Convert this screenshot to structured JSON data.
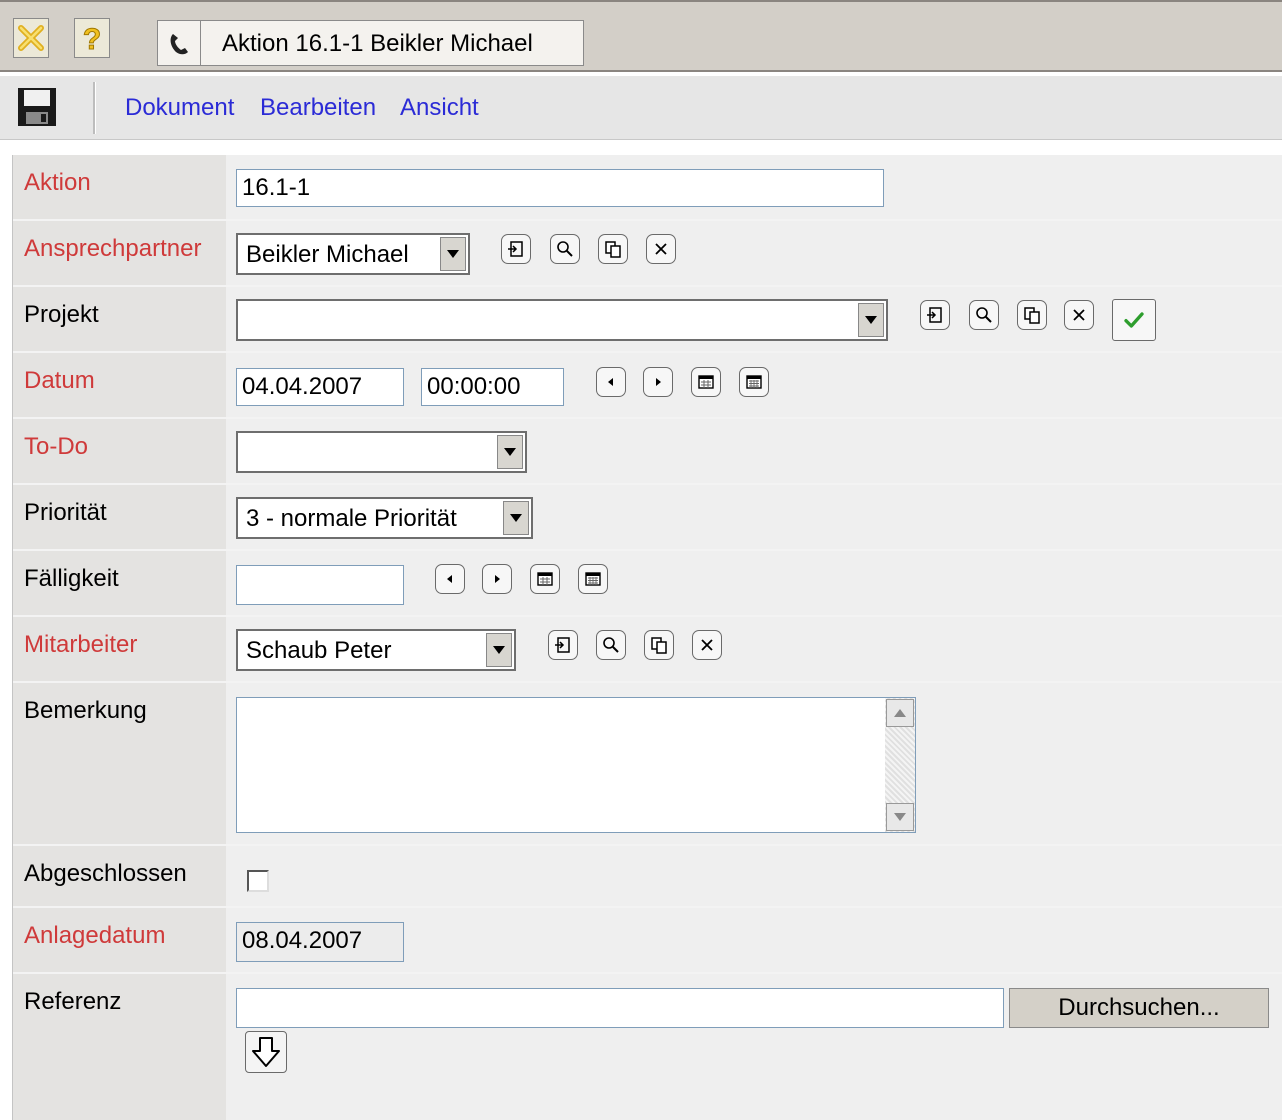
{
  "window": {
    "title": "Aktion 16.1-1 Beikler Michael",
    "icons": [
      "close-icon",
      "help-icon",
      "phone-icon"
    ]
  },
  "toolbar": {
    "save_icon": "floppy-disk-icon",
    "menu": [
      "Dokument",
      "Bearbeiten",
      "Ansicht"
    ]
  },
  "colors": {
    "required_label": "#cf3a3a",
    "menu_link": "#2b2bd6",
    "checkmark": "#2e9e2e"
  },
  "form": {
    "aktion": {
      "label": "Aktion",
      "value": "16.1-1",
      "required": true
    },
    "ansprechpartner": {
      "label": "Ansprechpartner",
      "value": "Beikler Michael",
      "required": true
    },
    "projekt": {
      "label": "Projekt",
      "value": "",
      "required": false
    },
    "datum": {
      "label": "Datum",
      "date": "04.04.2007",
      "time": "00:00:00",
      "required": true
    },
    "todo": {
      "label": "To-Do",
      "value": "",
      "required": true
    },
    "prioritaet": {
      "label": "Priorität",
      "value": "3 - normale Priorität",
      "required": false
    },
    "faelligkeit": {
      "label": "Fälligkeit",
      "value": "",
      "required": false
    },
    "mitarbeiter": {
      "label": "Mitarbeiter",
      "value": "Schaub Peter",
      "required": true
    },
    "bemerkung": {
      "label": "Bemerkung",
      "value": "",
      "required": false
    },
    "abgeschlossen": {
      "label": "Abgeschlossen",
      "checked": false,
      "required": false
    },
    "anlagedatum": {
      "label": "Anlagedatum",
      "value": "08.04.2007",
      "required": true
    },
    "referenz": {
      "label": "Referenz",
      "value": "",
      "browse_label": "Durchsuchen...",
      "required": false
    }
  }
}
